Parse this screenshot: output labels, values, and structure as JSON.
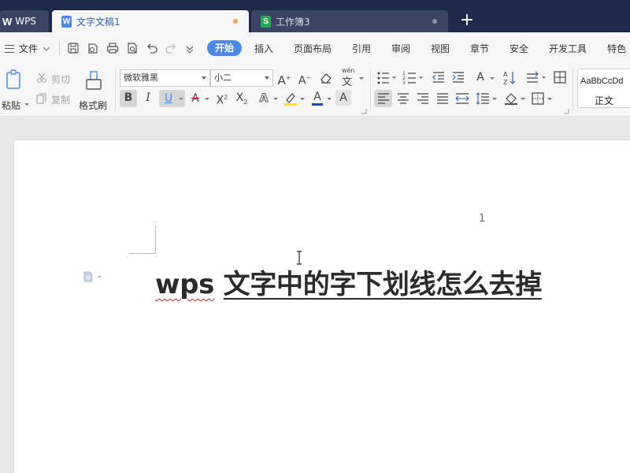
{
  "tabbar": {
    "app_tab": {
      "label": "WPS",
      "logo": "W"
    },
    "tabs": [
      {
        "label": "文字文稿1",
        "icon": "W",
        "icon_color": "#4d8ae6",
        "dot_color": "#f0a55e"
      },
      {
        "label": "工作簿3",
        "icon": "S",
        "icon_color": "#29a657",
        "dot_color": "#8a93a8"
      }
    ],
    "new_tab": "+"
  },
  "menubar": {
    "file_menu": "文件",
    "tabs": [
      "开始",
      "插入",
      "页面布局",
      "引用",
      "审阅",
      "视图",
      "章节",
      "安全",
      "开发工具",
      "特色"
    ]
  },
  "ribbon": {
    "clipboard": {
      "paste": "粘贴",
      "cut": "剪切",
      "copy": "复制",
      "format_painter": "格式刷"
    },
    "font": {
      "family": "微软雅黑",
      "size": "小二",
      "phonetic_label": "wén"
    },
    "style_preview": {
      "sample": "AaBbCcDd",
      "name": "正文"
    },
    "accent_color": "#4d8ae6"
  },
  "document": {
    "page_number": "1",
    "heading_latin": "wps",
    "heading_chinese": "文字中的字下划线怎么去掉"
  }
}
